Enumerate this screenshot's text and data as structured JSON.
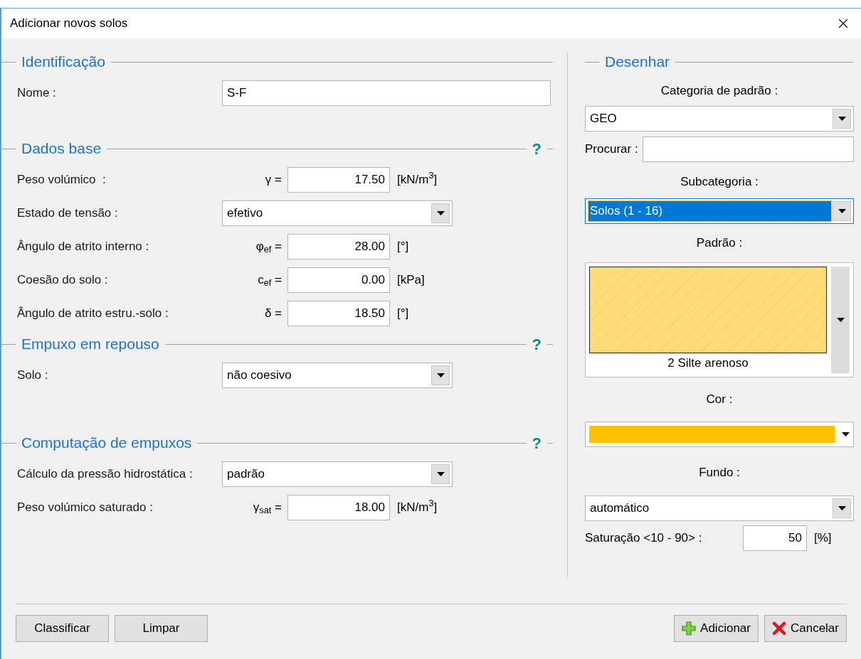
{
  "window": {
    "title": "Adicionar novos solos"
  },
  "sections": [
    {
      "title": "Identificação",
      "rows": [
        {
          "kind": "text",
          "label": "Nome :",
          "value": "S-F"
        }
      ]
    },
    {
      "title": "Dados base",
      "help": "?",
      "rows": [
        {
          "kind": "number",
          "label": "Peso volúmico  :",
          "symbol": "γ =",
          "value": "17.50",
          "unit": "[kN/m$^{3}$]"
        },
        {
          "kind": "select",
          "label": "Estado de tensão :",
          "value": "efetivo"
        },
        {
          "kind": "number",
          "label": "Ângulo de atrito interno :",
          "symbol": "φ$_{ef}$ =",
          "value": "28.00",
          "unit": "[°]"
        },
        {
          "kind": "number",
          "label": "Coesão do solo :",
          "symbol": "c$_{ef}$ =",
          "value": "0.00",
          "unit": "[kPa]"
        },
        {
          "kind": "number",
          "label": "Ângulo de atrito estru.-solo :",
          "symbol": "δ =",
          "value": "18.50",
          "unit": "[°]"
        }
      ]
    },
    {
      "title": "Empuxo em repouso",
      "help": "?",
      "rows": [
        {
          "kind": "select",
          "label": "Solo :",
          "value": "não coesivo"
        }
      ]
    },
    {
      "title": "Computação de empuxos",
      "help": "?",
      "rows": [
        {
          "kind": "select",
          "label": "Cálculo da pressão hidrostática :",
          "value": "padrão"
        },
        {
          "kind": "number",
          "label": "Peso volúmico saturado :",
          "symbol": "γ$_{sat}$ =",
          "value": "18.00",
          "unit": "[kN/m$^{3}$]"
        }
      ]
    }
  ],
  "draw": {
    "title": "Desenhar",
    "category": {
      "label": "Categoria de padrão :",
      "value": "GEO"
    },
    "search": {
      "label": "Procurar :"
    },
    "subcategory": {
      "label": "Subcategoria :",
      "value": "Solos (1 - 16)",
      "focused": true
    },
    "pattern": {
      "label": "Padrão :",
      "name": "2 Silte arenoso"
    },
    "color": {
      "label": "Cor :",
      "color": "#ffc000"
    },
    "background": {
      "label": "Fundo :",
      "value": "automático"
    },
    "saturation": {
      "label": "Saturação <10 - 90> :",
      "value": "50",
      "unit": "[%]"
    }
  },
  "buttons_left": [
    "Classificar",
    "Limpar"
  ],
  "buttons_right": [
    {
      "kind": "add",
      "label": "Adicionar"
    },
    {
      "kind": "cancel",
      "label": "Cancelar"
    }
  ]
}
